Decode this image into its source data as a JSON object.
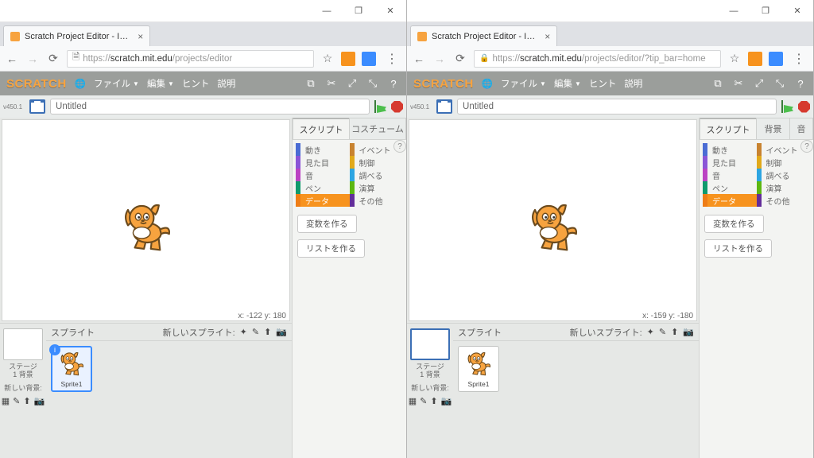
{
  "os": {
    "title": "Scratch Project Editor",
    "min": "—",
    "max": "❐",
    "close": "✕"
  },
  "tab": {
    "title": "Scratch Project Editor - I…",
    "close": "×"
  },
  "addr_left": {
    "secure_icon": "🗎",
    "prefix": "https://",
    "host": "scratch.mit.edu",
    "path": "/projects/editor"
  },
  "addr_right": {
    "secure_icon": "🔒",
    "prefix": "https://",
    "host": "scratch.mit.edu",
    "path": "/projects/editor/?tip_bar=home"
  },
  "chrome": {
    "star": "☆",
    "menu": "⋮",
    "back": "←",
    "fwd": "→",
    "reload": "⟳"
  },
  "logo": "SCRATCH",
  "globe": "🌐",
  "menu": {
    "file": "ファイル",
    "edit": "編集",
    "hint": "ヒント",
    "about": "説明"
  },
  "tools": {
    "stamp": "⌘",
    "cut": "✂",
    "grow": "⤢",
    "shrink": "⤡",
    "help": "?"
  },
  "version_left": "v450.1",
  "version_right": "v450.1",
  "title": "Untitled",
  "stage_readout_left": "x: -122  y: 180",
  "stage_readout_right": "x: -159  y: -180",
  "sprite_header": "スプライト",
  "new_sprite": "新しいスプライト:",
  "stage_thumb": {
    "label": "ステージ",
    "sub": "1 背景"
  },
  "new_bg": "新しい背景:",
  "sprite1": "Sprite1",
  "tabs": {
    "scripts": "スクリプト",
    "costumes": "コスチューム",
    "backdrops": "背景",
    "sounds": "音"
  },
  "cats": {
    "motion": "動き",
    "looks": "見た目",
    "sound": "音",
    "pen": "ペン",
    "data": "データ",
    "events": "イベント",
    "control": "制御",
    "sensing": "調べる",
    "operators": "演算",
    "more": "その他"
  },
  "palette_btns": {
    "makevar": "変数を作る",
    "makelist": "リストを作る"
  }
}
